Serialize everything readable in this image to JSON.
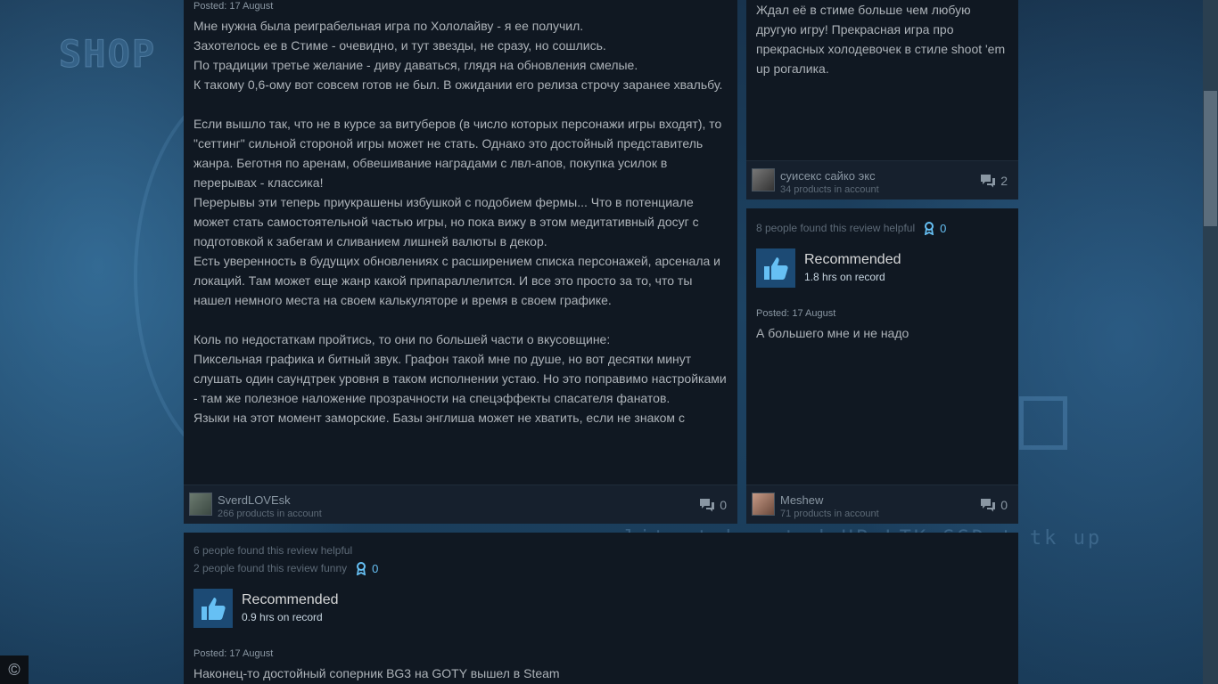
{
  "review_left": {
    "posted": "Posted: 17 August",
    "text": "Мне нужна была реиграбельная игра по Хололайву - я ее получил.\nЗахотелось ее в Стиме - очевидно, и тут звезды, не сразу, но сошлись.\nПо традиции третье желание - диву даваться, глядя на обновления смелые.\nК такому 0,6-ому вот совсем готов не был. В ожидании его релиза строчу заранее хвальбу.\n\nЕсли вышло так, что не в курсе за витуберов (в число которых персонажи игры входят), то \"сеттинг\" сильной стороной игры может не стать. Однако это достойный представитель жанра. Беготня по аренам, обвешивание наградами с лвл-апов, покупка усилок в перерывах - классика!\nПерерывы эти теперь приукрашены избушкой с подобием фермы... Что в потенциале может стать самостоятельной частью игры, но пока вижу в этом медитативный досуг с подготовкой к забегам и сливанием лишней валюты в декор.\nЕсть уверенность в будущих обновлениях с расширением списка персонажей, арсенала и локаций. Там может еще жанр какой припараллелится. И все это просто за то, что ты нашел немного места на своем калькуляторе и время в своем графике.\n\nКоль по недостаткам пройтись, то они по большей части о вкусовщине:\nПиксельная графика и битный звук. Графон такой мне по душе, но вот десятки минут слушать один саундтрек уровня в таком исполнении устаю. Но это поправимо настройками - там же полезное наложение прозрачности на спецэффекты спасателя фанатов.\nЯзыки на этот момент заморские. Базы энглиша может не хватить, если не знаком с",
    "author": {
      "name": "SverdLOVEsk",
      "products": "266 products in account"
    },
    "comments": "0"
  },
  "review_top_right": {
    "text": "Ждал её в стиме больше чем любую другую игру! Прекрасная игра про прекрасных холодевочек в стиле shoot 'em up рогалика.",
    "author": {
      "name": "суисекс сайко экс",
      "products": "34 products in account"
    },
    "comments": "2"
  },
  "review_mid_right": {
    "helpful": "8 people found this review helpful",
    "awards": "0",
    "recommendation": "Recommended",
    "hours": "1.8 hrs on record",
    "posted": "Posted: 17 August",
    "text": "А большего мне и не надо",
    "author": {
      "name": "Meshew",
      "products": "71 products in account"
    },
    "comments": "0"
  },
  "review_bottom": {
    "helpful": "6 people found this review helpful",
    "funny": "2 people found this review funny",
    "awards": "0",
    "recommendation": "Recommended",
    "hours": "0.9 hrs on record",
    "posted": "Posted: 17 August",
    "text": "Наконец-то достойный соперник BG3 на GOTY вышел в Steam"
  },
  "background": {
    "shop_text": "SHOP",
    "strip_text": "lit et  ha  nt  d  HP  LTK  SSD t  tk up to"
  },
  "icons": {
    "comment": "speech-bubbles-icon",
    "award": "award-ribbon-icon",
    "recommend": "thumbs-up-icon",
    "cc": "copyright-icon"
  },
  "corner_badge": "©",
  "colors": {
    "card_bg": "#101822",
    "footer_bg": "#16202d",
    "accent": "#66c0f4",
    "thumb_bg": "#1c4a74"
  }
}
